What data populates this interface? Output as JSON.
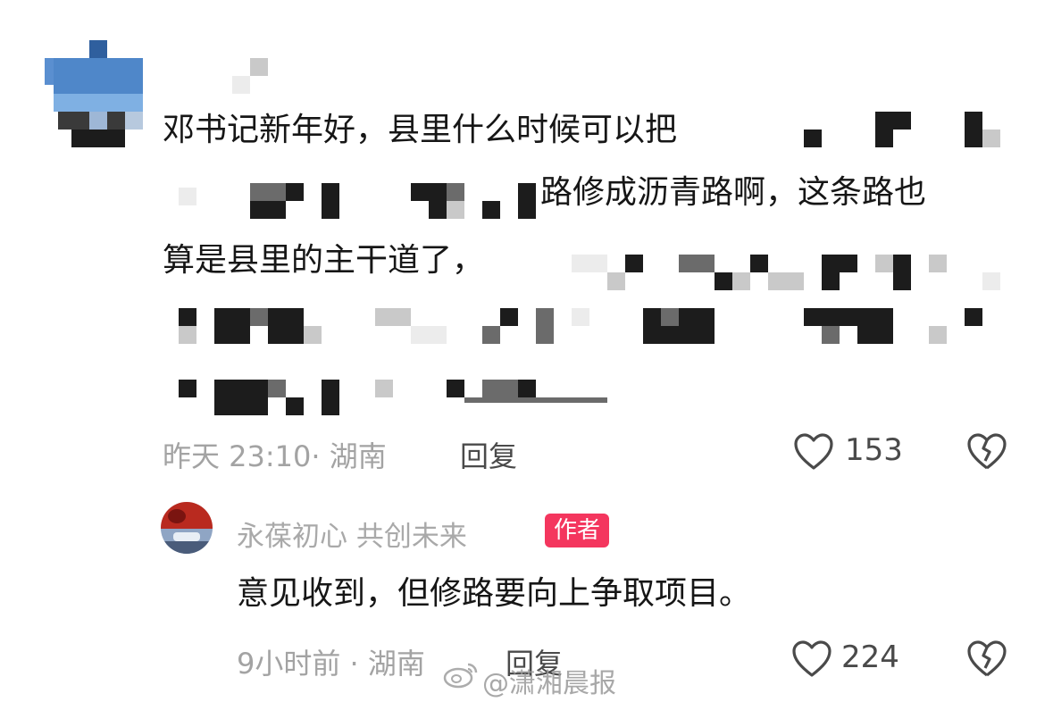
{
  "comment1": {
    "line1": "邓书记新年好，县里什么时候可以把",
    "line2": "路修成沥青路啊，这条路也",
    "line3": "算是县里的主干道了，",
    "timestamp": "昨天 23:10",
    "location_sep": "·",
    "location": "湖南",
    "reply_label": "回复",
    "like_count": "153"
  },
  "reply1": {
    "username": "永葆初心  共创未来",
    "badge": "作者",
    "text": "意见收到，但修路要向上争取项目。",
    "timestamp": "9小时前",
    "location_sep": "·",
    "location": "湖南",
    "reply_label": "回复",
    "like_count": "224"
  },
  "watermark": "@潇湘晨报",
  "icons": {
    "like": "heart-outline-icon",
    "dislike": "broken-heart-icon",
    "weibo": "weibo-logo-icon"
  },
  "colors": {
    "badge": "#f4365e",
    "meta": "#a3a3a3"
  }
}
